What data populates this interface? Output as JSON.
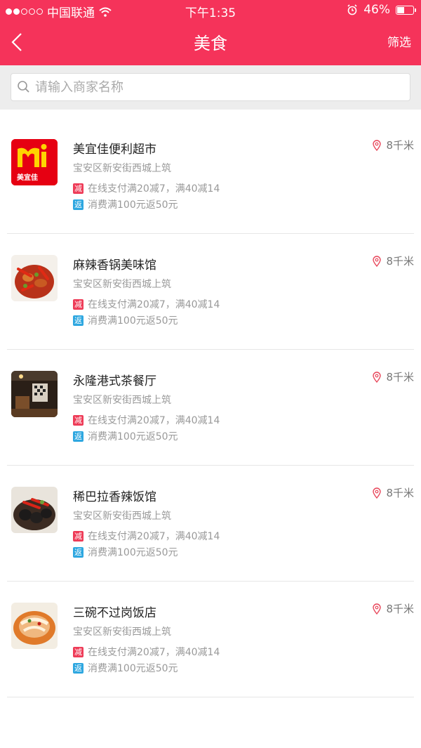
{
  "status_bar": {
    "carrier": "中国联通",
    "time": "下午1:35",
    "battery": "46%"
  },
  "header": {
    "title": "美食",
    "filter_label": "筛选",
    "background": "#f5335a"
  },
  "search": {
    "placeholder": "请输入商家名称",
    "value": ""
  },
  "stores": [
    {
      "name": "美宜佳便利超市",
      "address": "宝安区新安街西城上筑",
      "discount_tag": "减",
      "discount_text": "在线支付满20减7，满40减14",
      "rebate_tag": "返",
      "rebate_text": "消费满100元返50元",
      "distance": "8千米",
      "logo_text": "美宜佳"
    },
    {
      "name": "麻辣香锅美味馆",
      "address": "宝安区新安街西城上筑",
      "discount_tag": "减",
      "discount_text": "在线支付满20减7，满40减14",
      "rebate_tag": "返",
      "rebate_text": "消费满100元返50元",
      "distance": "8千米"
    },
    {
      "name": "永隆港式茶餐厅",
      "address": "宝安区新安街西城上筑",
      "discount_tag": "减",
      "discount_text": "在线支付满20减7，满40减14",
      "rebate_tag": "返",
      "rebate_text": "消费满100元返50元",
      "distance": "8千米"
    },
    {
      "name": "稀巴拉香辣饭馆",
      "address": "宝安区新安街西城上筑",
      "discount_tag": "减",
      "discount_text": "在线支付满20减7，满40减14",
      "rebate_tag": "返",
      "rebate_text": "消费满100元返50元",
      "distance": "8千米"
    },
    {
      "name": "三碗不过岗饭店",
      "address": "宝安区新安街西城上筑",
      "discount_tag": "减",
      "discount_text": "在线支付满20减7，满40减14",
      "rebate_tag": "返",
      "rebate_text": "消费满100元返50元",
      "distance": "8千米"
    }
  ]
}
